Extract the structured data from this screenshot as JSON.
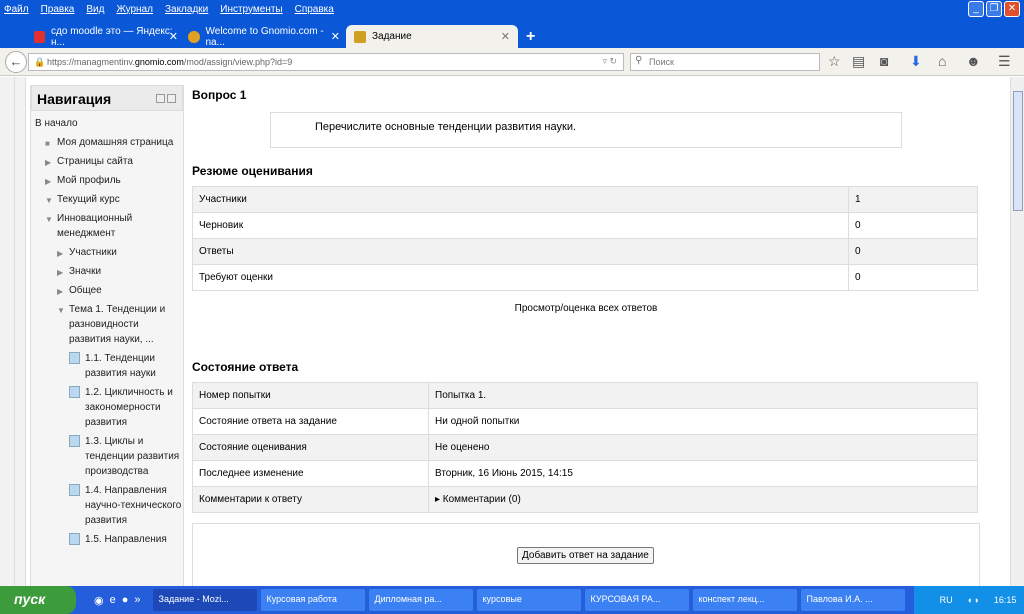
{
  "menu": [
    "Файл",
    "Правка",
    "Вид",
    "Журнал",
    "Закладки",
    "Инструменты",
    "Справка"
  ],
  "tabs": [
    {
      "label": "сдо moodle это — Яндекс: н...",
      "color": "#e03030"
    },
    {
      "label": "Welcome to Gnomio.com - na...",
      "color": "#e0a020"
    },
    {
      "label": "Задание",
      "color": "#d0a020"
    }
  ],
  "new_tab": "+",
  "url": {
    "prefix": "https://managmentinv.",
    "domain": "gnomio.com",
    "path": "/mod/assign/view.php?id=9"
  },
  "search_placeholder": "Поиск",
  "nav": {
    "title": "Навигация",
    "items": [
      {
        "label": "В начало",
        "level": 0,
        "kind": "none"
      },
      {
        "label": "Моя домашняя страница",
        "level": 1,
        "kind": "bullet"
      },
      {
        "label": "Страницы сайта",
        "level": 1,
        "kind": "closed"
      },
      {
        "label": "Мой профиль",
        "level": 1,
        "kind": "closed"
      },
      {
        "label": "Текущий курс",
        "level": 1,
        "kind": "open"
      },
      {
        "label": "Инновационный менеджмент",
        "level": 2,
        "kind": "open"
      },
      {
        "label": "Участники",
        "level": 3,
        "kind": "closed"
      },
      {
        "label": "Значки",
        "level": 3,
        "kind": "closed"
      },
      {
        "label": "Общее",
        "level": 3,
        "kind": "closed"
      },
      {
        "label": "Тема 1. Тенденции и разновидности развития науки, ...",
        "level": 3,
        "kind": "open"
      },
      {
        "label": "1.1. Тенденции развития науки",
        "level": 4,
        "kind": "doc"
      },
      {
        "label": "1.2. Цикличность и закономерности развития",
        "level": 4,
        "kind": "doc"
      },
      {
        "label": "1.3. Циклы и тенденции развития производства",
        "level": 4,
        "kind": "doc"
      },
      {
        "label": "1.4. Направления научно-технического развития",
        "level": 4,
        "kind": "doc"
      },
      {
        "label": "1.5. Направления",
        "level": 4,
        "kind": "doc"
      }
    ]
  },
  "main": {
    "question_title": "Вопрос 1",
    "question_text": "Перечислите основные тенденции развития науки.",
    "summary_title": "Резюме оценивания",
    "summary_rows": [
      [
        "Участники",
        "1"
      ],
      [
        "Черновик",
        "0"
      ],
      [
        "Ответы",
        "0"
      ],
      [
        "Требуют оценки",
        "0"
      ]
    ],
    "view_all": "Просмотр/оценка всех ответов",
    "status_title": "Состояние ответа",
    "status_rows": [
      [
        "Номер попытки",
        "Попытка 1."
      ],
      [
        "Состояние ответа на задание",
        "Ни одной попытки"
      ],
      [
        "Состояние оценивания",
        "Не оценено"
      ],
      [
        "Последнее изменение",
        "Вторник, 16 Июнь 2015, 14:15"
      ],
      [
        "Комментарии к ответу",
        "Комментарии (0)"
      ]
    ],
    "add_button": "Добавить ответ на задание"
  },
  "taskbar": {
    "start": "пуск",
    "tasks": [
      "Задание - Mozi...",
      "Курсовая работа",
      "Дипломная ра...",
      "курсовые",
      "КУРСОВАЯ РА...",
      "конспект лекц...",
      "Павлова И.А. ..."
    ],
    "lang": "RU",
    "time": "16:15"
  }
}
